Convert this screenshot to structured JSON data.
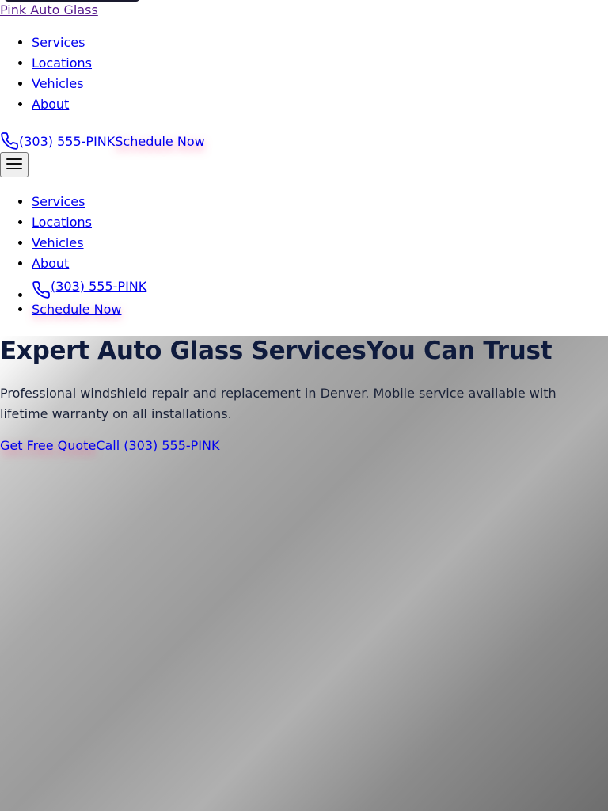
{
  "brand": {
    "name": "Pink Auto Glass"
  },
  "nav": {
    "items": [
      {
        "label": "Services"
      },
      {
        "label": "Locations"
      },
      {
        "label": "Vehicles"
      },
      {
        "label": "About"
      }
    ]
  },
  "header": {
    "phone_label": "(303) 555-PINK",
    "schedule_label": "Schedule Now",
    "phone_icon": "phone-icon",
    "menu_icon": "hamburger-menu-icon"
  },
  "mobile_nav": {
    "items": [
      {
        "label": "Services"
      },
      {
        "label": "Locations"
      },
      {
        "label": "Vehicles"
      },
      {
        "label": "About"
      }
    ],
    "phone_label": "(303) 555-PINK",
    "schedule_label": "Schedule Now"
  },
  "hero": {
    "title_part1": "Expert Auto Glass Services",
    "title_part2": "You Can Trust",
    "description": "Professional windshield repair and replacement in Denver. Mobile service available with lifetime warranty on all installations.",
    "primary_cta": "Get Free Quote",
    "secondary_cta": "Call (303) 555-PINK"
  },
  "colors": {
    "link": "#0000ee",
    "visited_link": "#551a8b",
    "title": "#0f1b3d",
    "accent_glow": "#ff508c"
  }
}
